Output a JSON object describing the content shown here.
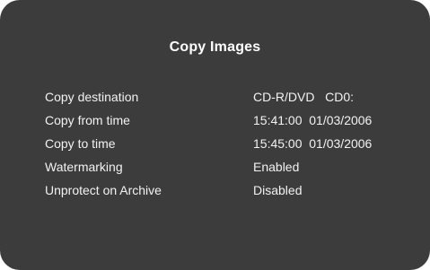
{
  "dialog": {
    "title": "Copy Images",
    "rows": [
      {
        "label": "Copy destination",
        "value": "CD-R/DVD   CD0:"
      },
      {
        "label": "Copy from time",
        "value": "15:41:00  01/03/2006"
      },
      {
        "label": "Copy to time",
        "value": "15:45:00  01/03/2006"
      },
      {
        "label": "Watermarking",
        "value": "Enabled"
      },
      {
        "label": "Unprotect on Archive",
        "value": "Disabled"
      }
    ]
  },
  "colors": {
    "panel_background": "#3c3c3c",
    "text": "#f2f2f2"
  }
}
